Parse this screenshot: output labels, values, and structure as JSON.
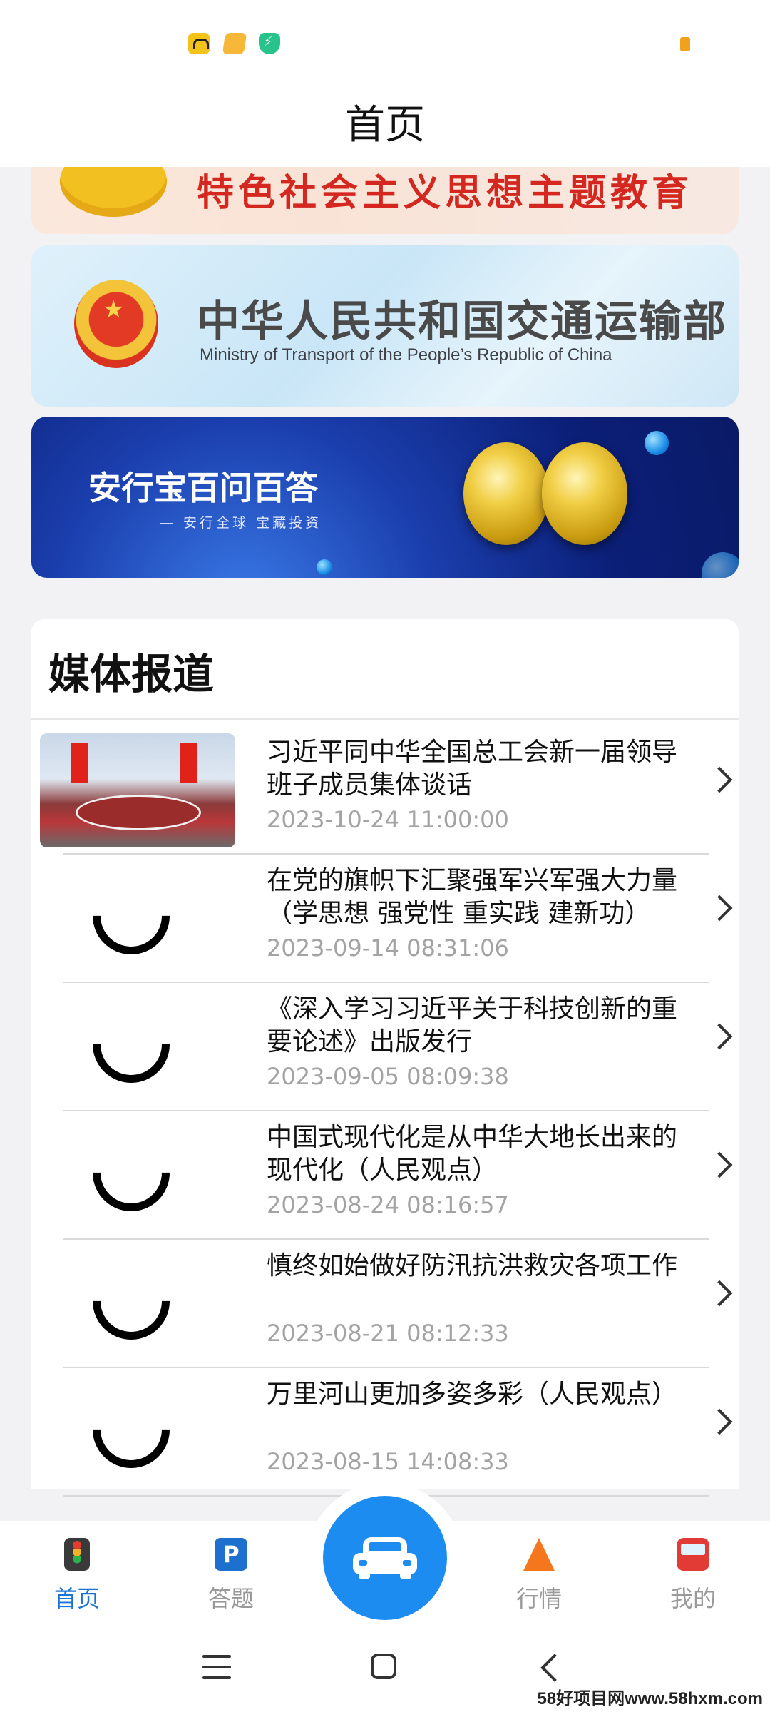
{
  "header": {
    "title": "首页"
  },
  "banners": {
    "banner1_text": "特色社会主义思想主题教育",
    "banner2_cn": "中华人民共和国交通运输部",
    "banner2_en": "Ministry of Transport of the People’s Republic of China",
    "banner3_title": "安行宝百问百答",
    "banner3_sub": "— 安行全球 宝藏投资"
  },
  "media": {
    "title": "媒体报道",
    "items": [
      {
        "title": "习近平同中华全国总工会新一届领导班子成员集体谈话",
        "date": "2023-10-24 11:00:00"
      },
      {
        "title": "在党的旗帜下汇聚强军兴军强大力量（学思想 强党性 重实践 建新功）",
        "date": "2023-09-14 08:31:06"
      },
      {
        "title": "《深入学习习近平关于科技创新的重要论述》出版发行",
        "date": "2023-09-05 08:09:38"
      },
      {
        "title": "中国式现代化是从中华大地长出来的现代化（人民观点）",
        "date": "2023-08-24 08:16:57"
      },
      {
        "title": "慎终如始做好防汛抗洪救灾各项工作",
        "date": "2023-08-21 08:12:33"
      },
      {
        "title": "万里河山更加多姿多彩（人民观点）",
        "date": "2023-08-15 14:08:33"
      }
    ]
  },
  "nav": {
    "home": "首页",
    "quiz": "答题",
    "market": "行情",
    "mine": "我的"
  },
  "watermark": "58好项目网www.58hxm.com",
  "colors": {
    "accent": "#1b73d6",
    "fab": "#1d8cf0"
  }
}
